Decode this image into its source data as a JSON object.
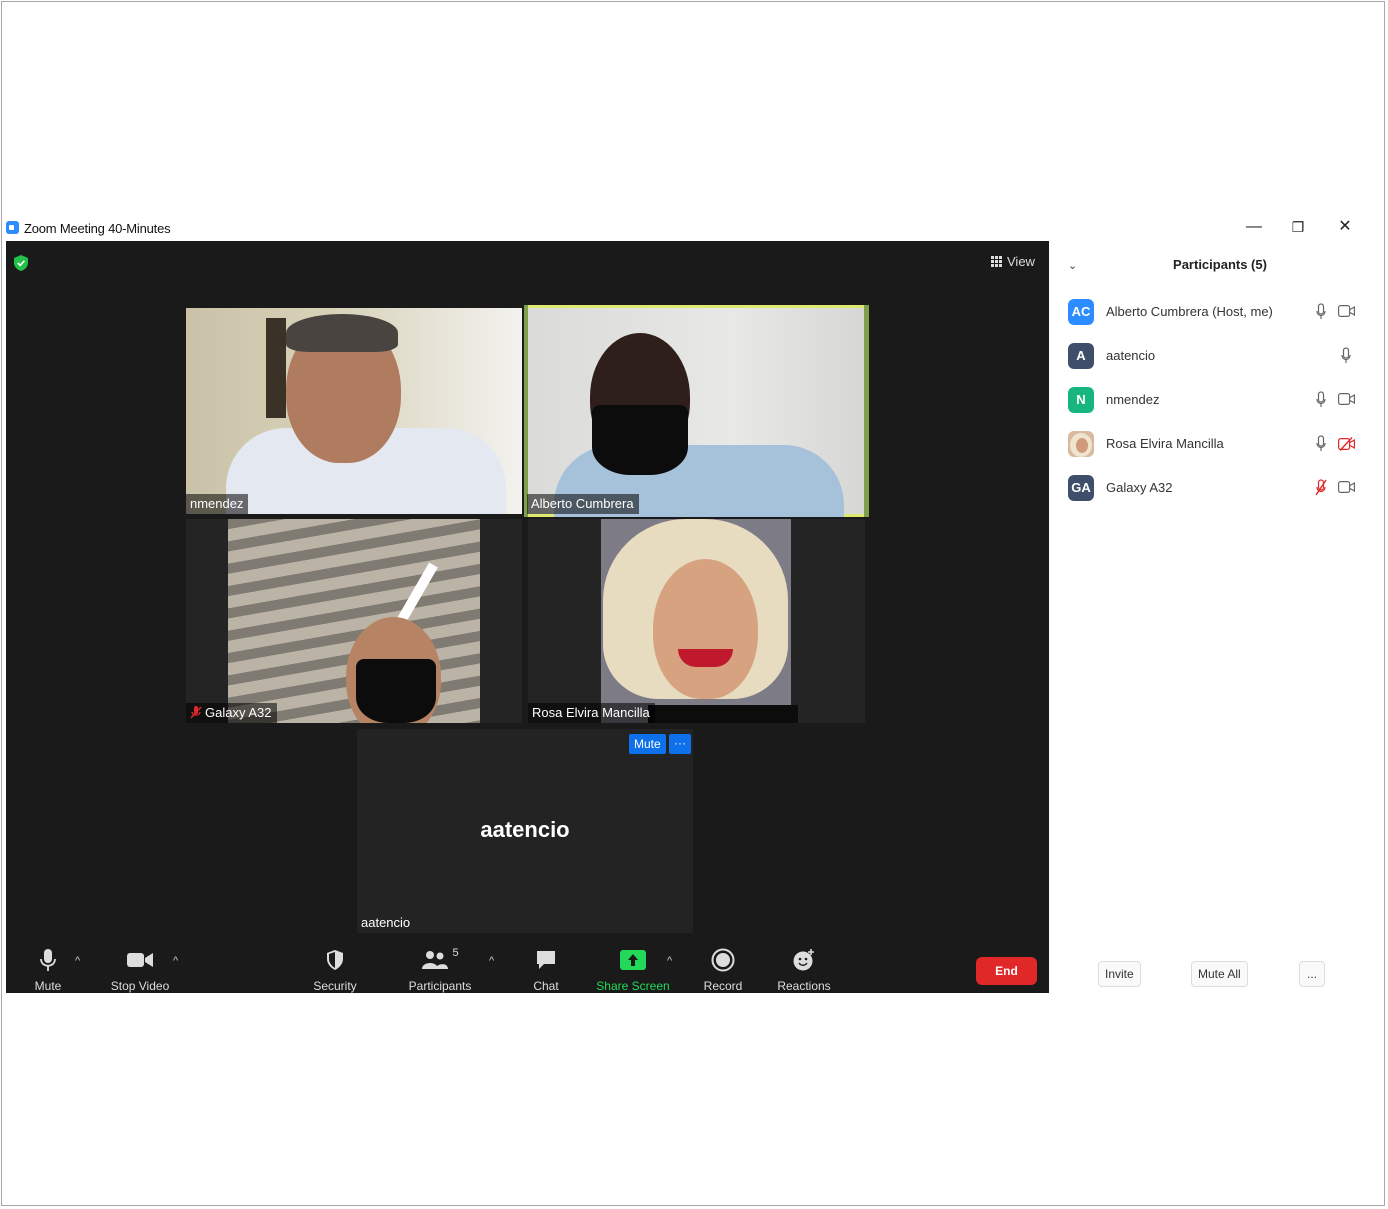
{
  "window": {
    "title": "Zoom Meeting 40-Minutes",
    "minimize": "—",
    "restore": "❐",
    "close": "✕"
  },
  "meeting": {
    "view_label": "View",
    "tiles": [
      {
        "name": "nmendez"
      },
      {
        "name": "Alberto Cumbrera"
      },
      {
        "name": "Galaxy A32"
      },
      {
        "name": "Rosa Elvira Mancilla"
      },
      {
        "name": "aatencio",
        "big_name": "aatencio",
        "mute_label": "Mute",
        "more_label": "···"
      }
    ]
  },
  "toolbar": {
    "mute": "Mute",
    "stop_video": "Stop Video",
    "security": "Security",
    "participants": "Participants",
    "participants_count": "5",
    "chat": "Chat",
    "share_screen": "Share Screen",
    "record": "Record",
    "reactions": "Reactions",
    "end": "End",
    "colors": {
      "share": "#23d959",
      "end": "#e02828"
    }
  },
  "panel": {
    "title": "Participants (5)",
    "participants": [
      {
        "initials": "AC",
        "name": "Alberto Cumbrera (Host, me)",
        "color": "#2d8cff"
      },
      {
        "initials": "A",
        "name": "aatencio",
        "color": "#3f4f6b"
      },
      {
        "initials": "N",
        "name": "nmendez",
        "color": "#17b67f"
      },
      {
        "initials": "",
        "name": "Rosa Elvira Mancilla",
        "color": "#d9b9a0"
      },
      {
        "initials": "GA",
        "name": "Galaxy A32",
        "color": "#3f4f6b"
      }
    ],
    "invite": "Invite",
    "mute_all": "Mute All",
    "more": "..."
  }
}
